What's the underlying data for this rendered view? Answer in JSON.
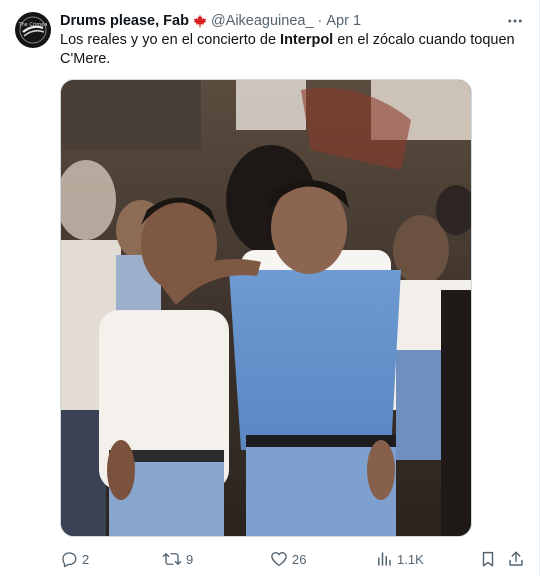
{
  "tweet": {
    "author_name": "Drums please, Fab",
    "handle": "@Aikeaguinea_",
    "separator": "·",
    "date": "Apr 1",
    "text_part1": "Los reales y yo en el concierto de ",
    "text_bold": "Interpol",
    "text_part2": " en el zócalo cuando toquen C'Mere.",
    "avatar_text": "The Crimea",
    "icons": {
      "author_flag": "maple-leaf-icon",
      "more": "more-horizontal-icon",
      "reply": "reply-icon",
      "retweet": "retweet-icon",
      "like": "heart-icon",
      "views": "views-chart-icon",
      "bookmark": "bookmark-icon",
      "share": "share-icon"
    }
  },
  "stats": {
    "replies": "2",
    "retweets": "9",
    "likes": "26",
    "views": "1.1K"
  },
  "colors": {
    "text": "#0f1419",
    "secondary": "#536471",
    "maple_leaf": "#d9201f",
    "border": "#cfd9de"
  }
}
